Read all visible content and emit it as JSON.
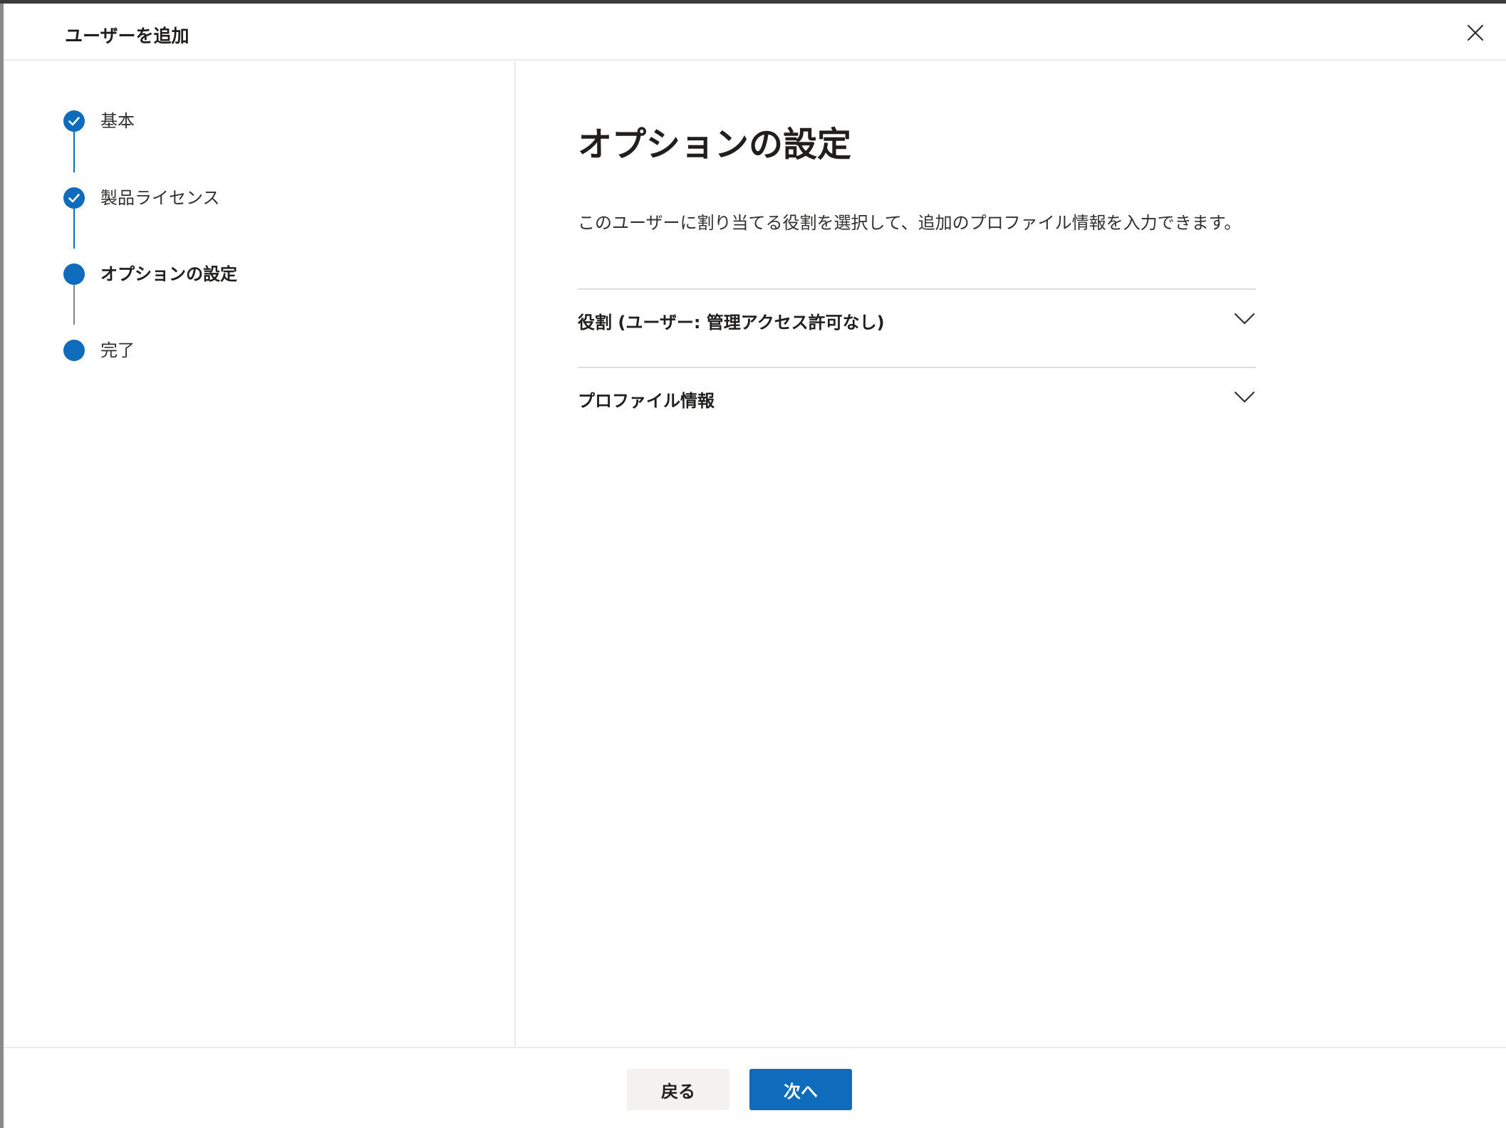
{
  "dialog": {
    "title": "ユーザーを追加",
    "close_icon": "close-icon"
  },
  "steps": [
    {
      "label": "基本",
      "state": "completed",
      "icon": "checkmark-icon"
    },
    {
      "label": "製品ライセンス",
      "state": "completed",
      "icon": "checkmark-icon"
    },
    {
      "label": "オプションの設定",
      "state": "current",
      "icon": "filled-circle-icon"
    },
    {
      "label": "完了",
      "state": "upcoming",
      "icon": "filled-circle-icon"
    }
  ],
  "main": {
    "title": "オプションの設定",
    "description": "このユーザーに割り当てる役割を選択して、追加のプロファイル情報を入力できます。",
    "sections": [
      {
        "label": "役割 (ユーザー: 管理アクセス許可なし)",
        "expanded": false,
        "icon": "chevron-down-icon"
      },
      {
        "label": "プロファイル情報",
        "expanded": false,
        "icon": "chevron-down-icon"
      }
    ]
  },
  "footer": {
    "back_label": "戻る",
    "next_label": "次へ"
  },
  "colors": {
    "accent": "#0f6cbd",
    "divider": "#edebe9",
    "secondary_button_bg": "#f3f2f1"
  }
}
